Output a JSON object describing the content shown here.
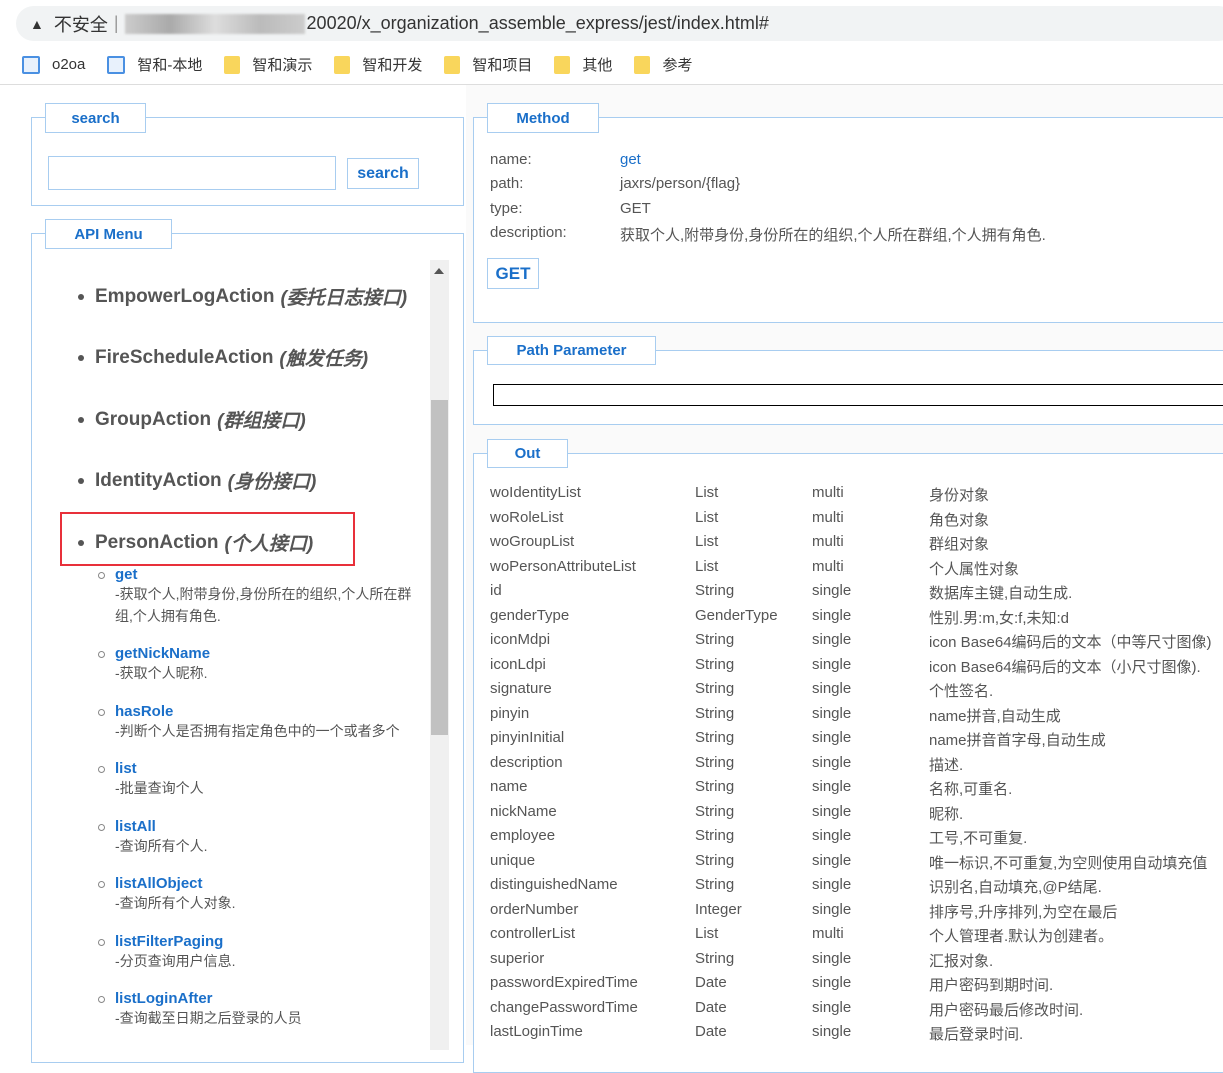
{
  "browser": {
    "security": "不安全",
    "url": "20020/x_organization_assemble_express/jest/index.html#",
    "bookmarks": [
      {
        "label": "o2oa",
        "icon": "page-icon"
      },
      {
        "label": "智和-本地",
        "icon": "page-icon"
      },
      {
        "label": "智和演示",
        "icon": "folder-icon"
      },
      {
        "label": "智和开发",
        "icon": "folder-icon"
      },
      {
        "label": "智和项目",
        "icon": "folder-icon"
      },
      {
        "label": "其他",
        "icon": "folder-icon"
      },
      {
        "label": "参考",
        "icon": "folder-icon"
      }
    ]
  },
  "search": {
    "legend": "search",
    "input_value": "",
    "button": "search"
  },
  "menu": {
    "legend": "API Menu",
    "items": [
      {
        "name": "EmpowerLogAction",
        "cn": "(委托日志接口)"
      },
      {
        "name": "FireScheduleAction",
        "cn": "(触发任务)"
      },
      {
        "name": "GroupAction",
        "cn": "(群组接口)"
      },
      {
        "name": "IdentityAction",
        "cn": "(身份接口)"
      },
      {
        "name": "PersonAction",
        "cn": "(个人接口)"
      }
    ],
    "subitems": [
      {
        "name": "get",
        "desc": "-获取个人,附带身份,身份所在的组织,个人所在群组,个人拥有角色."
      },
      {
        "name": "getNickName",
        "desc": "-获取个人昵称."
      },
      {
        "name": "hasRole",
        "desc": "-判断个人是否拥有指定角色中的一个或者多个"
      },
      {
        "name": "list",
        "desc": "-批量查询个人"
      },
      {
        "name": "listAll",
        "desc": "-查询所有个人."
      },
      {
        "name": "listAllObject",
        "desc": "-查询所有个人对象."
      },
      {
        "name": "listFilterPaging",
        "desc": "-分页查询用户信息."
      },
      {
        "name": "listLoginAfter",
        "desc": "-查询截至日期之后登录的人员"
      }
    ]
  },
  "method": {
    "legend": "Method",
    "labels": {
      "name": "name:",
      "path": "path:",
      "type": "type:",
      "description": "description:"
    },
    "name": "get",
    "path": "jaxrs/person/{flag}",
    "type": "GET",
    "description": "获取个人,附带身份,身份所在的组织,个人所在群组,个人拥有角色.",
    "button": "GET"
  },
  "path_parameter": {
    "legend": "Path Parameter"
  },
  "out": {
    "legend": "Out",
    "rows": [
      [
        "woIdentityList",
        "List",
        "multi",
        "身份对象"
      ],
      [
        "woRoleList",
        "List",
        "multi",
        "角色对象"
      ],
      [
        "woGroupList",
        "List",
        "multi",
        "群组对象"
      ],
      [
        "woPersonAttributeList",
        "List",
        "multi",
        "个人属性对象"
      ],
      [
        "id",
        "String",
        "single",
        "数据库主键,自动生成."
      ],
      [
        "genderType",
        "GenderType",
        "single",
        "性别.男:m,女:f,未知:d"
      ],
      [
        "iconMdpi",
        "String",
        "single",
        "icon Base64编码后的文本（中等尺寸图像)"
      ],
      [
        "iconLdpi",
        "String",
        "single",
        "icon Base64编码后的文本（小尺寸图像)."
      ],
      [
        "signature",
        "String",
        "single",
        "个性签名."
      ],
      [
        "pinyin",
        "String",
        "single",
        "name拼音,自动生成"
      ],
      [
        "pinyinInitial",
        "String",
        "single",
        "name拼音首字母,自动生成"
      ],
      [
        "description",
        "String",
        "single",
        "描述."
      ],
      [
        "name",
        "String",
        "single",
        "名称,可重名."
      ],
      [
        "nickName",
        "String",
        "single",
        "昵称."
      ],
      [
        "employee",
        "String",
        "single",
        "工号,不可重复."
      ],
      [
        "unique",
        "String",
        "single",
        "唯一标识,不可重复,为空则使用自动填充值"
      ],
      [
        "distinguishedName",
        "String",
        "single",
        "识别名,自动填充,@P结尾."
      ],
      [
        "orderNumber",
        "Integer",
        "single",
        "排序号,升序排列,为空在最后"
      ],
      [
        "controllerList",
        "List",
        "multi",
        "个人管理者.默认为创建者。"
      ],
      [
        "superior",
        "String",
        "single",
        "汇报对象."
      ],
      [
        "passwordExpiredTime",
        "Date",
        "single",
        "用户密码到期时间."
      ],
      [
        "changePasswordTime",
        "Date",
        "single",
        "用户密码最后修改时间."
      ],
      [
        "lastLoginTime",
        "Date",
        "single",
        "最后登录时间."
      ]
    ]
  }
}
